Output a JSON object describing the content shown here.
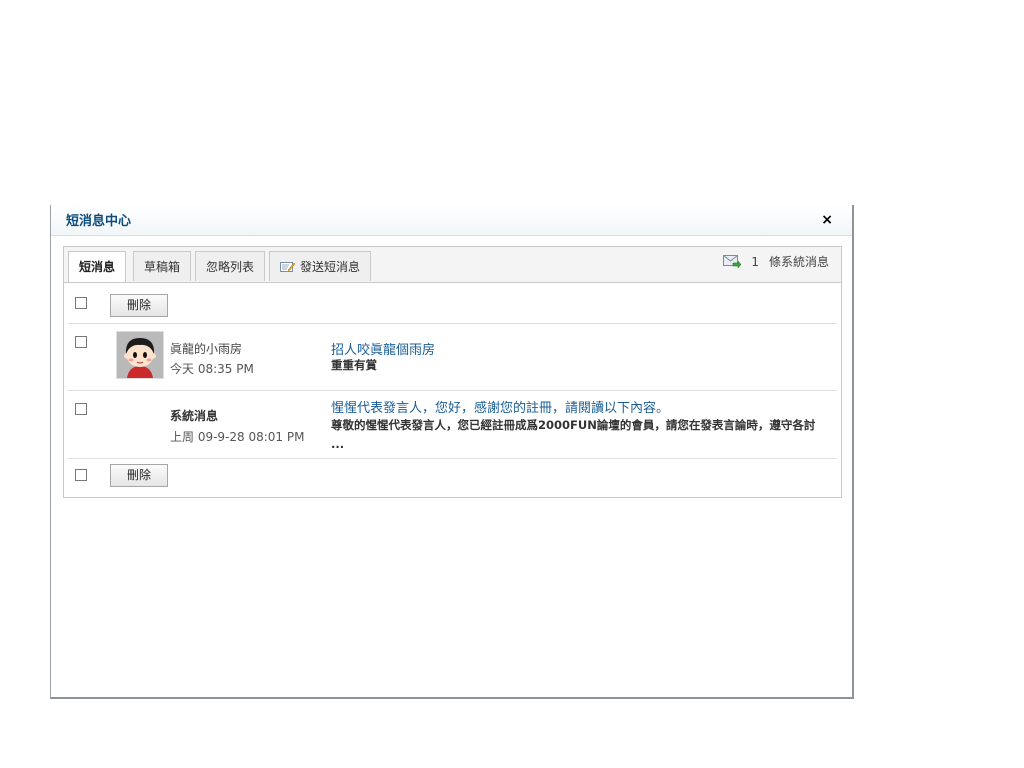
{
  "dialog": {
    "title": "短消息中心",
    "close_label": "×"
  },
  "tabs": [
    {
      "label": "短消息",
      "active": true
    },
    {
      "label": "草稿箱",
      "active": false
    },
    {
      "label": "忽略列表",
      "active": false
    },
    {
      "label": "發送短消息",
      "active": false,
      "icon": "compose-icon"
    }
  ],
  "system_notice": {
    "icon": "mail-icon",
    "count": "1",
    "label": "條系統消息"
  },
  "toolbar": {
    "delete_label": "刪除"
  },
  "messages": [
    {
      "sender": "眞龍的小雨房",
      "time": "今天 08:35 PM",
      "subject": "招人咬眞龍個雨房",
      "preview": "重重有賞",
      "has_avatar": true
    },
    {
      "sender": "系統消息",
      "time": "上周 09-9-28 08:01 PM",
      "subject": "惺惺代表發言人，您好，感謝您的註冊，請閱讀以下內容。",
      "preview": "尊敬的惺惺代表發言人，您已經註冊成爲2000FUN論壇的會員，請您在發表言論時，遵守各討 ...",
      "has_avatar": false
    }
  ],
  "colors": {
    "title": "#0e4d7b",
    "link": "#1a5d95"
  }
}
